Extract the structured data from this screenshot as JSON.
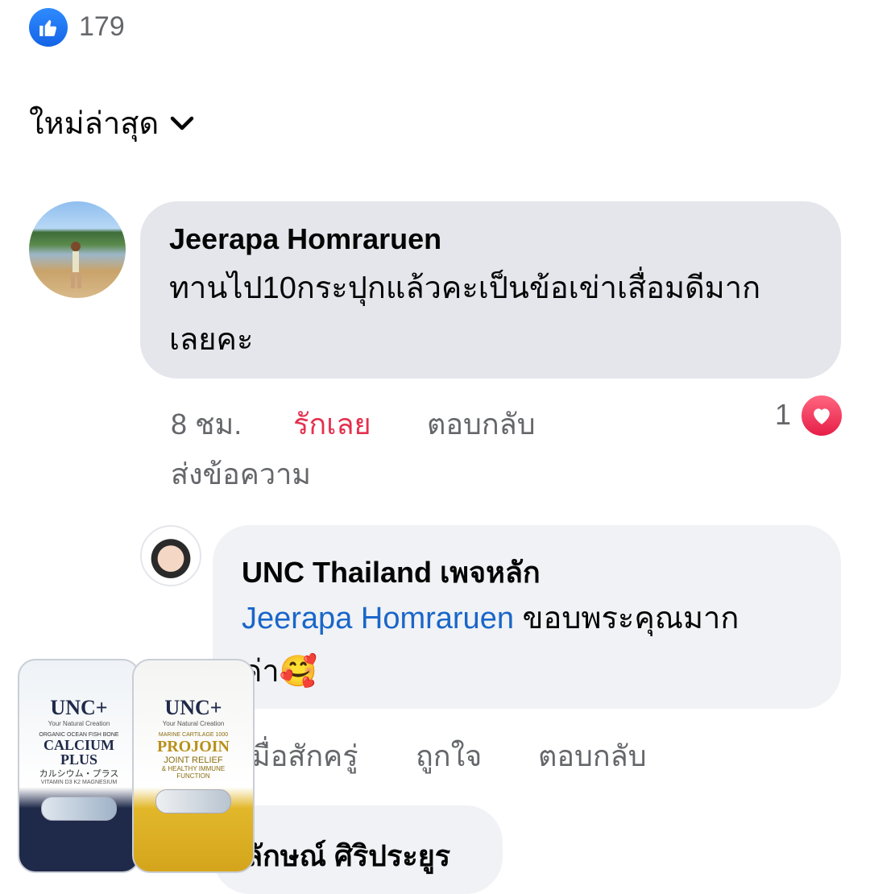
{
  "reactions": {
    "count": "179"
  },
  "sort": {
    "label": "ใหม่ล่าสุด"
  },
  "comment1": {
    "author": "Jeerapa Homraruen",
    "text_line1": "ทานไป10กระปุกแล้วคะเป็นข้อเข่าเสื่อมดีมาก",
    "text_line2": "เลยคะ",
    "time": "8 ชม.",
    "love_label": "รักเลย",
    "reply_label": "ตอบกลับ",
    "message_label": "ส่งข้อความ",
    "reaction_count": "1"
  },
  "reply1": {
    "author": "UNC Thailand เพจหลัก",
    "mention": "Jeerapa Homraruen",
    "text_rest": " ขอบพระคุณมาก",
    "text_line2": "ค่า🥰",
    "action_partial": "มื่อสักครู่",
    "like_label": "ถูกใจ",
    "reply_label": "ตอบกลับ"
  },
  "comment3": {
    "author_partial": "ลักษณ์ ศิริประยูร"
  },
  "product": {
    "can1_brand": "UNC+",
    "can1_tagline": "Your Natural Creation",
    "can1_sub": "ORGANIC OCEAN FISH BONE",
    "can1_name1": "CALCIUM",
    "can1_name2": "PLUS",
    "can1_jp": "カルシウム・プラス",
    "can1_vit": "VITAMIN D3 K2 MAGNESIUM",
    "can2_brand": "UNC+",
    "can2_tagline": "Your Natural Creation",
    "can2_sub": "MARINE CARTILAGE 1000",
    "can2_name": "PROJOIN",
    "can2_line1": "JOINT RELIEF",
    "can2_line2": "& HEALTHY IMMUNE",
    "can2_line3": "FUNCTION"
  },
  "colors": {
    "like_blue": "#1877f2",
    "love_red": "#e4314e",
    "mention_blue": "#1a66c9"
  }
}
